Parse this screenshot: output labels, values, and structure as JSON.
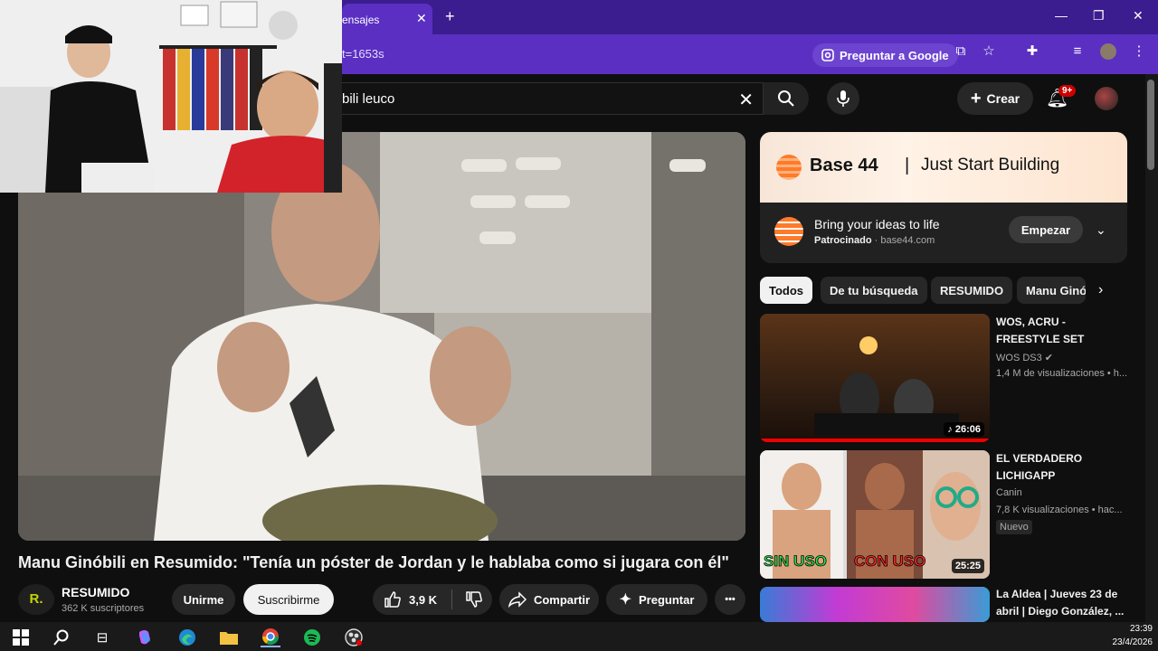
{
  "browser": {
    "tab_title": "ensajes",
    "tab_close": "✕",
    "new_tab": "+",
    "url_text": "t=1653s",
    "ask_google": "Preguntar a Google",
    "win_min": "—",
    "win_restore": "❐",
    "win_close": "✕"
  },
  "header": {
    "search_text": "bili leuco",
    "create_label": "Crear",
    "notif_badge": "9+"
  },
  "video": {
    "title": "Manu Ginóbili en Resumido: \"Tenía un póster de Jordan y le hablaba como si jugara con él\"",
    "channel_avatar": "R.",
    "channel_name": "RESUMIDO",
    "subscribers": "362 K suscriptores",
    "join_label": "Unirme",
    "subscribe_label": "Suscribirme",
    "likes": "3,9 K",
    "share_label": "Compartir",
    "ask_label": "Preguntar",
    "more_label": "•••"
  },
  "ad": {
    "brand": "Base 44",
    "separator": "|",
    "tagline": "Just Start Building",
    "headline": "Bring your ideas to life",
    "sponsored": "Patrocinado",
    "domain": " · base44.com",
    "cta": "Empezar"
  },
  "chips": [
    "Todos",
    "De tu búsqueda",
    "RESUMIDO",
    "Manu Ginó"
  ],
  "recommendations": [
    {
      "title": "WOS, ACRU - FREESTYLE SET",
      "channel": "WOS DS3",
      "meta": "1,4 M de visualizaciones • h...",
      "duration": "26:06"
    },
    {
      "title": "EL VERDADERO LICHIGAPP",
      "channel": "Canin",
      "meta": "7,8 K visualizaciones • hac...",
      "badge": "Nuevo",
      "duration": "25:25",
      "thumb_text_left": "SIN USO",
      "thumb_text_right": "CON USO"
    },
    {
      "title": "La Aldea | Jueves 23 de abril | Diego González, ..."
    }
  ],
  "taskbar": {
    "time": "23:39",
    "date": "23/4/2026"
  },
  "colors": {
    "tab_bar": "#3b1d8f",
    "toolbar": "#5a2fc2",
    "yt_bg": "#0f0f0f",
    "notif_red": "#cc0000"
  }
}
